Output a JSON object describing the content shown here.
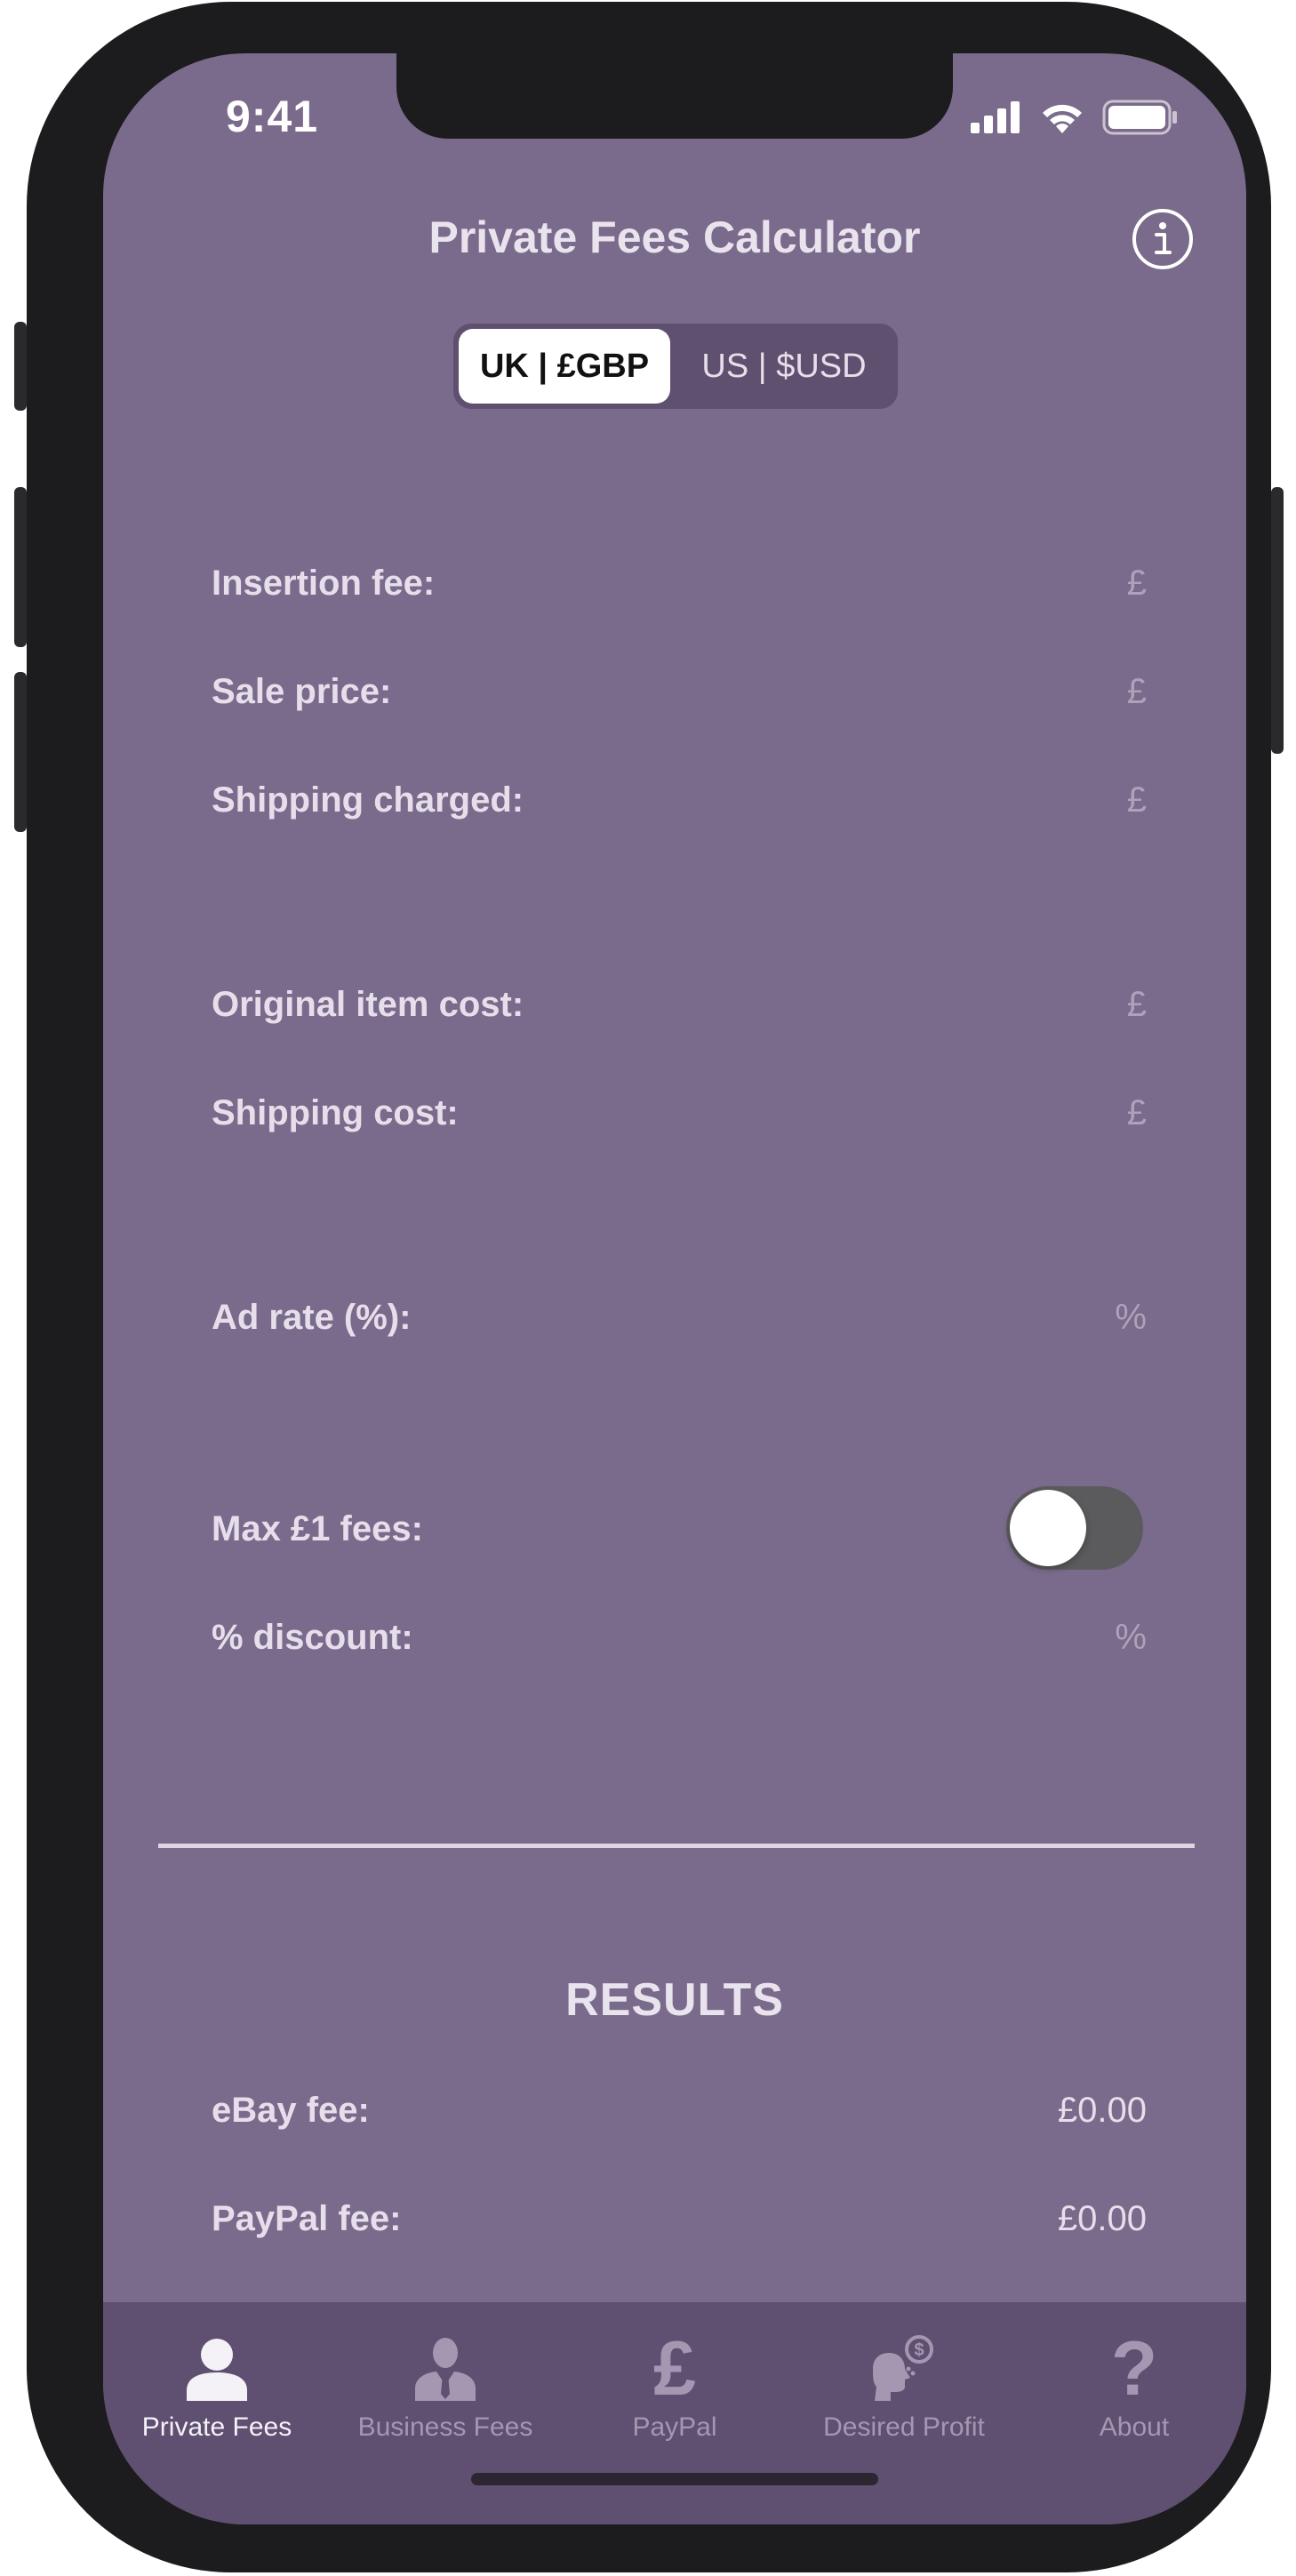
{
  "status_bar": {
    "time": "9:41"
  },
  "header": {
    "title": "Private Fees Calculator"
  },
  "currency_toggle": {
    "options": [
      "UK | £GBP",
      "US | $USD"
    ],
    "selected": "UK | £GBP"
  },
  "inputs": {
    "insertion_fee": {
      "label": "Insertion fee:",
      "unit": "£"
    },
    "sale_price": {
      "label": "Sale price:",
      "unit": "£"
    },
    "shipping_charged": {
      "label": "Shipping charged:",
      "unit": "£"
    },
    "original_item_cost": {
      "label": "Original item cost:",
      "unit": "£"
    },
    "shipping_cost": {
      "label": "Shipping cost:",
      "unit": "£"
    },
    "ad_rate": {
      "label": "Ad rate (%):",
      "unit": "%"
    },
    "max_fees": {
      "label": "Max £1 fees:",
      "enabled": false
    },
    "discount": {
      "label": "% discount:",
      "unit": "%"
    }
  },
  "results": {
    "heading": "RESULTS",
    "ebay_fee": {
      "label": "eBay fee:",
      "value": "£0.00"
    },
    "paypal_fee": {
      "label": "PayPal fee:",
      "value": "£0.00"
    }
  },
  "tabbar": {
    "items": [
      {
        "label": "Private Fees",
        "icon": "person-icon",
        "active": true
      },
      {
        "label": "Business Fees",
        "icon": "businessman-icon",
        "active": false
      },
      {
        "label": "PayPal",
        "icon": "pound-sign-icon",
        "active": false
      },
      {
        "label": "Desired Profit",
        "icon": "head-dollar-icon",
        "active": false
      },
      {
        "label": "About",
        "icon": "question-mark-icon",
        "active": false
      }
    ]
  },
  "colors": {
    "background": "#7a6a8b",
    "tabbar": "#5f4f70",
    "segment_background": "#5f506f",
    "toggle_off": "#5b5b5e",
    "text": "#e6dfeb",
    "muted_text": "#aea2ba"
  }
}
